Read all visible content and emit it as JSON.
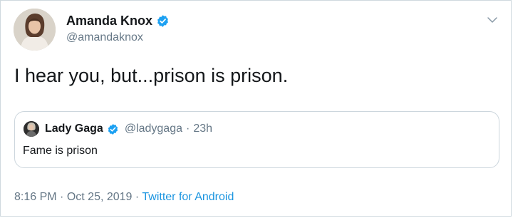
{
  "author": {
    "display_name": "Amanda Knox",
    "handle": "@amandaknox",
    "verified_icon": "verified-badge-icon",
    "avatar": "profile-photo"
  },
  "tweet": {
    "text": "I hear you, but...prison is prison."
  },
  "quoted_tweet": {
    "display_name": "Lady Gaga",
    "handle": "@ladygaga",
    "separator": "·",
    "time": "23h",
    "text": "Fame is prison",
    "verified_icon": "verified-badge-icon",
    "avatar": "profile-photo"
  },
  "meta": {
    "time": "8:16 PM",
    "separator": "·",
    "date": "Oct 25, 2019",
    "source": "Twitter for Android"
  },
  "menu_icon": "chevron-down-icon",
  "colors": {
    "accent": "#1da1f2",
    "link": "#1b95e0",
    "secondary_text": "#657786",
    "border": "#ccd6dd"
  }
}
